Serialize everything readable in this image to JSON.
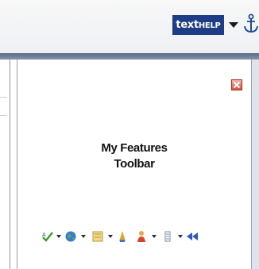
{
  "toolbar": {
    "brand_text": "text",
    "brand_caps": "HELP",
    "icons": [
      "dropdown-arrow-icon",
      "anchor-icon"
    ]
  },
  "panel": {
    "title_line1": "My Features",
    "title_line2": "Toolbar",
    "close_icon": "close-icon",
    "feature_icons": [
      "spell-check-icon",
      "globe-icon",
      "dictionary-icon",
      "word-prediction-icon",
      "speech-person-icon",
      "fact-finder-icon",
      "rewind-icon"
    ]
  },
  "colors": {
    "brand": "#1f3c86",
    "close": "#d9533d",
    "rule": "#5b6a86"
  }
}
